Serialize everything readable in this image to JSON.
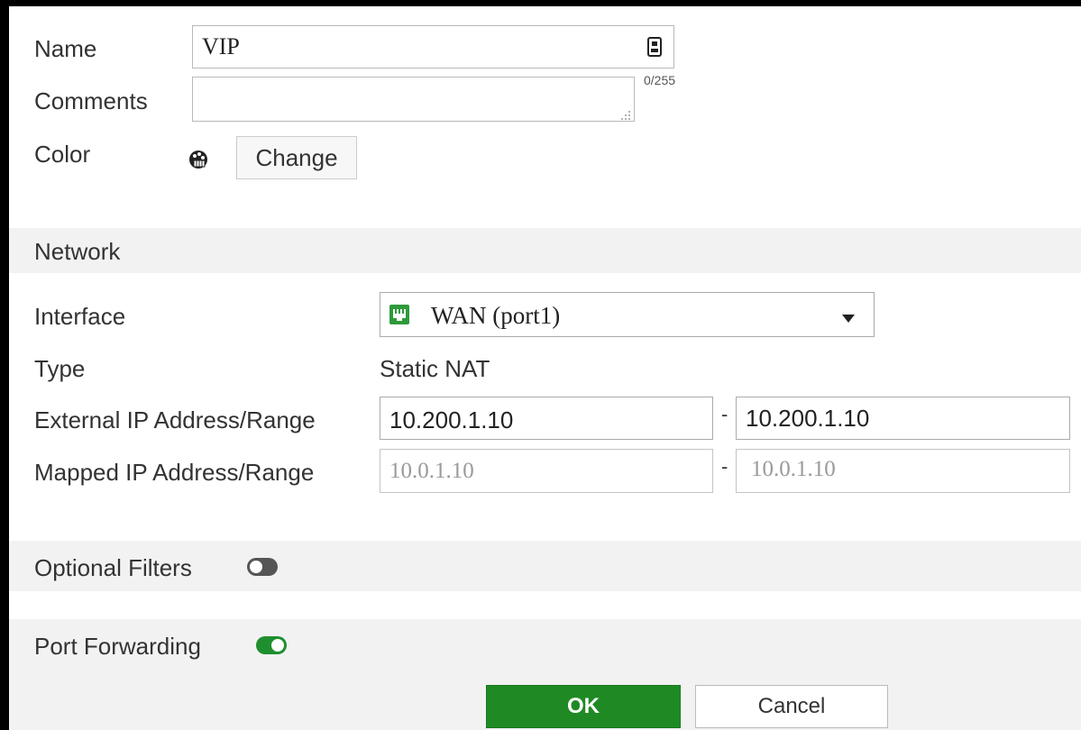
{
  "general": {
    "name_label": "Name",
    "name_value": "VIP",
    "char_count": "0/255",
    "comments_label": "Comments",
    "comments_value": "",
    "color_label": "Color",
    "change_button": "Change"
  },
  "network": {
    "section_title": "Network",
    "interface_label": "Interface",
    "interface_value": "WAN (port1)",
    "type_label": "Type",
    "type_value": "Static NAT",
    "external_label": "External IP Address/Range",
    "external_start": "10.200.1.10",
    "external_end": "10.200.1.10",
    "mapped_label": "Mapped IP Address/Range",
    "mapped_start_placeholder": "10.0.1.10",
    "mapped_end_placeholder": "10.0.1.10",
    "range_separator": "-"
  },
  "optional_filters": {
    "label": "Optional Filters",
    "enabled": false
  },
  "port_forwarding": {
    "label": "Port Forwarding",
    "enabled": true
  },
  "footer": {
    "ok_label": "OK",
    "cancel_label": "Cancel"
  },
  "colors": {
    "toggle_on": "#1e8f2f",
    "toggle_off": "#555555",
    "ok_button": "#1f8a24",
    "section_bg": "#f2f2f2",
    "interface_icon": "#2e9a3a"
  },
  "icons": {
    "name_field_icon": "form-fill-icon",
    "color_swatch_icon": "color-palette-icon",
    "interface_icon": "port-icon",
    "dropdown_icon": "caret-down-icon",
    "resize_icon": "resize-grip-icon"
  }
}
